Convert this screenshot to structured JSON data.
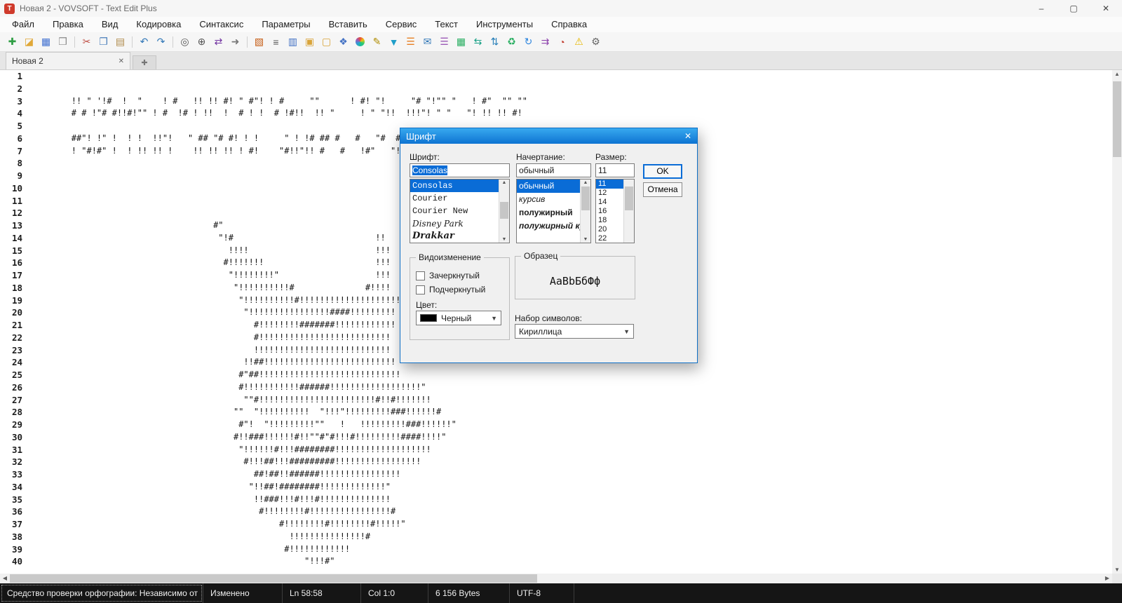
{
  "window": {
    "title": "Новая 2 - VOVSOFT - Text Edit Plus",
    "controls": [
      {
        "name": "minimize",
        "glyph": "–"
      },
      {
        "name": "maximize",
        "glyph": "▢"
      },
      {
        "name": "close",
        "glyph": "✕"
      }
    ]
  },
  "menubar": {
    "items": [
      {
        "id": "file",
        "label": "Файл"
      },
      {
        "id": "edit",
        "label": "Правка"
      },
      {
        "id": "view",
        "label": "Вид"
      },
      {
        "id": "encoding",
        "label": "Кодировка"
      },
      {
        "id": "syntax",
        "label": "Синтаксис"
      },
      {
        "id": "parameters",
        "label": "Параметры"
      },
      {
        "id": "insert",
        "label": "Вставить"
      },
      {
        "id": "service",
        "label": "Сервис"
      },
      {
        "id": "text",
        "label": "Текст"
      },
      {
        "id": "tools",
        "label": "Инструменты"
      },
      {
        "id": "help",
        "label": "Справка"
      }
    ]
  },
  "toolbar": {
    "groups": [
      [
        {
          "name": "new-file",
          "glyph": "✚",
          "color": "#2f9e44"
        },
        {
          "name": "open-folder",
          "glyph": "◪",
          "color": "#e0a838"
        },
        {
          "name": "save",
          "glyph": "▦",
          "color": "#3f6fd0"
        },
        {
          "name": "print",
          "glyph": "❒",
          "color": "#8a8a8a"
        }
      ],
      [
        {
          "name": "cut",
          "glyph": "✂",
          "color": "#c05046"
        },
        {
          "name": "copy",
          "glyph": "❐",
          "color": "#4a7ebb"
        },
        {
          "name": "paste",
          "glyph": "▤",
          "color": "#b08a4a"
        }
      ],
      [
        {
          "name": "undo",
          "glyph": "↶",
          "color": "#2e75b6"
        },
        {
          "name": "redo",
          "glyph": "↷",
          "color": "#2e75b6"
        }
      ],
      [
        {
          "name": "search",
          "glyph": "◎",
          "color": "#555555"
        },
        {
          "name": "zoom",
          "glyph": "⊕",
          "color": "#555555"
        },
        {
          "name": "find-replace",
          "glyph": "⇄",
          "color": "#7030a0"
        },
        {
          "name": "goto",
          "glyph": "➜",
          "color": "#777777"
        }
      ],
      [
        {
          "name": "image",
          "glyph": "▧",
          "color": "#c55a11"
        },
        {
          "name": "calculator",
          "glyph": "≡",
          "color": "#595959"
        },
        {
          "name": "chart",
          "glyph": "▥",
          "color": "#4472c4"
        },
        {
          "name": "lock",
          "glyph": "▣",
          "color": "#d9a43a"
        },
        {
          "name": "unlock",
          "glyph": "▢",
          "color": "#d9a43a"
        },
        {
          "name": "window",
          "glyph": "❖",
          "color": "#4472c4"
        },
        {
          "name": "color-wheel",
          "wheel": true
        },
        {
          "name": "pen",
          "glyph": "✎",
          "color": "#b08c00"
        },
        {
          "name": "filter",
          "glyph": "▼",
          "color": "#1f9ec9"
        },
        {
          "name": "sort",
          "glyph": "☰",
          "color": "#e67e22"
        },
        {
          "name": "mail",
          "glyph": "✉",
          "color": "#2e75b6"
        },
        {
          "name": "list",
          "glyph": "☰",
          "color": "#9b59b6"
        },
        {
          "name": "table",
          "glyph": "▦",
          "color": "#27ae60"
        },
        {
          "name": "arrows-horizontal",
          "glyph": "⇆",
          "color": "#16a085"
        },
        {
          "name": "arrows-vertical",
          "glyph": "⇅",
          "color": "#2980b9"
        },
        {
          "name": "recycle-bin",
          "glyph": "♻",
          "color": "#27ae60"
        },
        {
          "name": "refresh",
          "glyph": "↻",
          "color": "#2e86de"
        },
        {
          "name": "translate",
          "glyph": "⇉",
          "color": "#8e44ad"
        },
        {
          "name": "schedule",
          "glyph": "◔",
          "color": "#c0392b"
        },
        {
          "name": "warning",
          "glyph": "⚠",
          "color": "#e6b800"
        },
        {
          "name": "settings",
          "glyph": "⚙",
          "color": "#666666"
        }
      ]
    ]
  },
  "tabs": {
    "active_label": "Новая 2"
  },
  "editor": {
    "line_count": 40,
    "lines": [
      "",
      "",
      "        !! \" '!#  !  \"    ! #   !! !! #! \" #\"! ! #     \"\"      ! #! \"!     \"# \"!\"\" \"   ! #\"  \"\" \"\"",
      "        # # !\"# #!!#!\"\" ! #  !# ! !!  !  # ! !  # !#!!  !! \"     ! \" \"!!  !!!\"! \" \"   \"! !! !! #!",
      "",
      "        ##\"! !\" !  ! !  !!\"!   \" ## \"# #! ! !     \" ! !# ## #   #   \"#  #\"!  !\" \"!  !#  !!\"",
      "        ! \"#!#\" !  ! !! !! !    !! !! !! ! #!    \"#!!\"!! #   #   !#\"   \"!!  !\" !\" #! \"!\"",
      "",
      "",
      "",
      "",
      "",
      "                                    #\"",
      "                                     \"!#                            !!",
      "                                       !!!!                         !!!",
      "                                      #!!!!!!!                      !!!",
      "                                       \"!!!!!!!!\"                   !!!",
      "                                        \"!!!!!!!!!!#              #!!!!",
      "                                         \"!!!!!!!!!!#!!!!!!!!!!!!!!!!!!!!",
      "                                          \"!!!!!!!!!!!!!!!!####!!!!!!!!!",
      "                                            #!!!!!!!!#######!!!!!!!!!!!!",
      "                                            #!!!!!!!!!!!!!!!!!!!!!!!!!!",
      "                                            !!!!!!!!!!!!!!!!!!!!!!!!!!!",
      "                                          !!##!!!!!!!!!!!!!!!!!!!!!!!!!!",
      "                                         #\"##!!!!!!!!!!!!!!!!!!!!!!!!!!!!",
      "                                         #!!!!!!!!!!!######!!!!!!!!!!!!!!!!!!\"",
      "                                          \"\"#!!!!!!!!!!!!!!!!!!!!!!!#!!#!!!!!!!",
      "                                        \"\"  \"!!!!!!!!!!  \"!!!\"!!!!!!!!!###!!!!!!#",
      "                                         #\"!  \"!!!!!!!!!\"\"   !   !!!!!!!!!###!!!!!!\"",
      "                                        #!!###!!!!!!#!!\"\"#\"#!!!#!!!!!!!!!####!!!!\"",
      "                                         \"!!!!!!#!!!########!!!!!!!!!!!!!!!!!!!",
      "                                          #!!!##!!!#########!!!!!!!!!!!!!!!!!",
      "                                            ##!##!!######!!!!!!!!!!!!!!!!",
      "                                           \"!!##!########!!!!!!!!!!!!!\"",
      "                                            !!###!!!#!!!#!!!!!!!!!!!!!!",
      "                                             #!!!!!!!!#!!!!!!!!!!!!!!!!#",
      "                                                 #!!!!!!!!#!!!!!!!!#!!!!!\"",
      "                                                   !!!!!!!!!!!!!!!#",
      "                                                  #!!!!!!!!!!!!",
      "                                                      \"!!!#\""
    ]
  },
  "dialog": {
    "title": "Шрифт",
    "font": {
      "label": "Шрифт:",
      "value": "Consolas",
      "options": [
        {
          "label": "Consolas",
          "cls": "mono",
          "selected": true
        },
        {
          "label": "Courier",
          "cls": "mono"
        },
        {
          "label": "Courier New",
          "cls": "mono"
        },
        {
          "label": "Disney Park",
          "cls": "script"
        },
        {
          "label": "Drakkar",
          "cls": "blackletter"
        }
      ]
    },
    "style": {
      "label": "Начертание:",
      "value": "обычный",
      "options": [
        {
          "label": "обычный",
          "selected": true
        },
        {
          "label": "курсив",
          "cls": "italic"
        },
        {
          "label": "полужирный",
          "cls": "bold"
        },
        {
          "label": "полужирный курсив",
          "cls": "bolditalic"
        }
      ]
    },
    "size": {
      "label": "Размер:",
      "value": "11",
      "options": [
        {
          "label": "11",
          "selected": true
        },
        {
          "label": "12"
        },
        {
          "label": "14"
        },
        {
          "label": "16"
        },
        {
          "label": "18"
        },
        {
          "label": "20"
        },
        {
          "label": "22"
        }
      ]
    },
    "buttons": {
      "ok": "OK",
      "cancel": "Отмена"
    },
    "effects": {
      "label": "Видоизменение",
      "strikeout": "Зачеркнутый",
      "underline": "Подчеркнутый"
    },
    "color": {
      "label": "Цвет:",
      "value": "Черный",
      "swatch": "#000000"
    },
    "sample": {
      "label": "Образец",
      "text": "АаВbБбФф"
    },
    "charset": {
      "label": "Набор символов:",
      "value": "Кириллица"
    }
  },
  "statusbar": {
    "items": [
      {
        "name": "spellcheck-status",
        "label": "Средство проверки орфографии: Независимо от"
      },
      {
        "name": "modified-status",
        "label": "Изменено"
      },
      {
        "name": "line-indicator",
        "label": "Ln 58:58"
      },
      {
        "name": "column-indicator",
        "label": "Col 1:0"
      },
      {
        "name": "bytes-indicator",
        "label": "6 156 Bytes"
      },
      {
        "name": "encoding-indicator",
        "label": "UTF-8"
      }
    ]
  }
}
